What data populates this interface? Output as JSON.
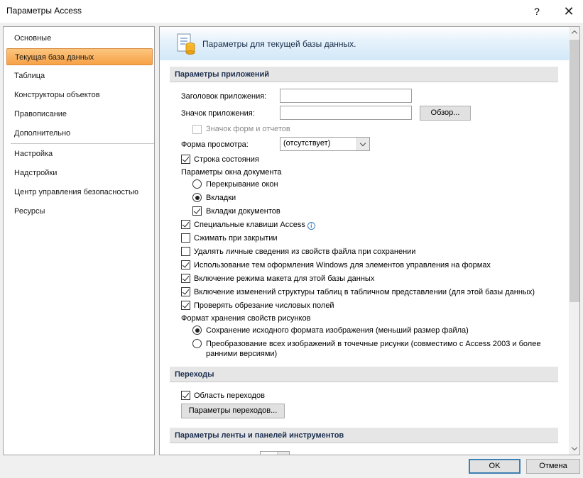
{
  "window": {
    "title": "Параметры Access",
    "help_label": "?",
    "close_label": "✕"
  },
  "sidebar": {
    "items": [
      {
        "label": "Основные",
        "active": false
      },
      {
        "label": "Текущая база данных",
        "active": true
      },
      {
        "label": "Таблица",
        "active": false
      },
      {
        "label": "Конструкторы объектов",
        "active": false
      },
      {
        "label": "Правописание",
        "active": false
      },
      {
        "label": "Дополнительно",
        "active": false
      },
      {
        "label": "Настройка",
        "active": false
      },
      {
        "label": "Надстройки",
        "active": false
      },
      {
        "label": "Центр управления безопасностью",
        "active": false
      },
      {
        "label": "Ресурсы",
        "active": false
      }
    ]
  },
  "banner": {
    "text": "Параметры для текущей базы данных.",
    "icon": "document-options-icon"
  },
  "app_options": {
    "header": "Параметры приложений",
    "app_title_label": "Заголовок приложения:",
    "app_title_value": "",
    "app_icon_label": "Значок приложения:",
    "app_icon_value": "",
    "browse_button": "Обзор...",
    "icon_forms_reports": {
      "label": "Значок форм и отчетов",
      "checked": false,
      "disabled": true
    },
    "display_form_label": "Форма просмотра:",
    "display_form_value": "(отсутствует)",
    "status_bar": {
      "label": "Строка состояния",
      "checked": true
    },
    "doc_window_label": "Параметры окна документа",
    "overlapping": {
      "label": "Перекрывание окон",
      "selected": false
    },
    "tabbed": {
      "label": "Вкладки",
      "selected": true
    },
    "doc_tabs": {
      "label": "Вкладки документов",
      "checked": true
    },
    "access_keys": {
      "label": "Специальные клавиши Access",
      "checked": true,
      "info_icon": "i"
    },
    "compact_on_close": {
      "label": "Сжимать при закрытии",
      "checked": false
    },
    "remove_personal": {
      "label": "Удалять личные сведения из свойств файла при сохранении",
      "checked": false
    },
    "windows_themes": {
      "label": "Использование тем оформления Windows для элементов управления на формах",
      "checked": true
    },
    "layout_view": {
      "label": "Включение режима макета для этой базы данных",
      "checked": true
    },
    "datasheet_design": {
      "label": "Включение изменений структуры таблиц в табличном представлении (для этой базы данных)",
      "checked": true
    },
    "truncated_fields": {
      "label": "Проверять обрезание числовых полей",
      "checked": true
    },
    "picture_format_label": "Формат хранения свойств рисунков",
    "preserve_format": {
      "label": "Сохранение исходного формата изображения (меньший размер файла)",
      "selected": true
    },
    "convert_bitmaps": {
      "label_line1": "Преобразование всех изображений в точечные рисунки (совместимо с Access 2003 и более",
      "label_line2": "ранними версиями)",
      "selected": false
    }
  },
  "navigation": {
    "header": "Переходы",
    "display_nav_pane": {
      "label": "Область переходов",
      "checked": true
    },
    "nav_options_button": "Параметры переходов..."
  },
  "ribbon": {
    "header": "Параметры ленты и панелей инструментов"
  },
  "footer": {
    "ok_button": "OK",
    "cancel_button": "Отмена"
  },
  "colors": {
    "active_nav": "#f7a146",
    "section_header_text": "#1b2d4e",
    "banner_gradient_end": "#d2e8f8"
  }
}
